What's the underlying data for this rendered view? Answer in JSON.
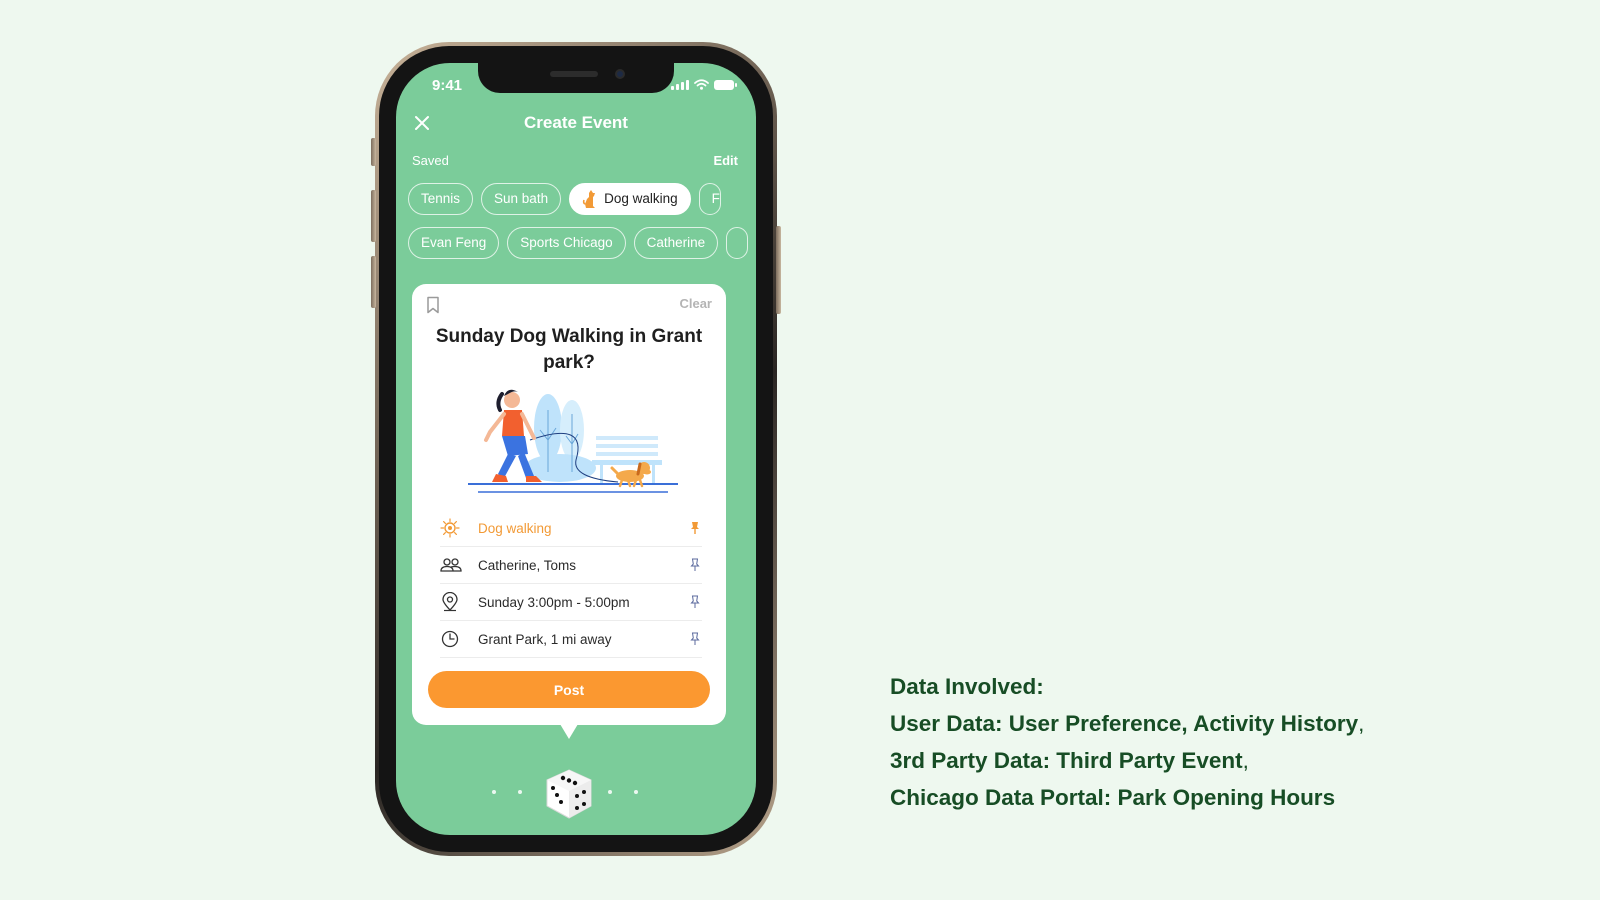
{
  "status_bar": {
    "time": "9:41"
  },
  "header": {
    "title": "Create Event",
    "saved_label": "Saved",
    "edit_label": "Edit"
  },
  "activity_chips": [
    {
      "label": "Tennis",
      "active": false
    },
    {
      "label": "Sun bath",
      "active": false
    },
    {
      "label": "Dog walking",
      "active": true,
      "icon": "dog-icon"
    },
    {
      "label": "F",
      "active": false,
      "truncated": true
    }
  ],
  "people_chips": [
    {
      "label": "Evan Feng"
    },
    {
      "label": "Sports Chicago"
    },
    {
      "label": "Catherine"
    },
    {
      "label": "",
      "truncated": true
    }
  ],
  "card": {
    "clear_label": "Clear",
    "title": "Sunday Dog Walking in Grant park?",
    "illustration": "woman-walking-dog-in-park-illustration",
    "details": [
      {
        "icon": "sun-icon",
        "text": "Dog walking",
        "pinned": true,
        "highlight": true
      },
      {
        "icon": "people-icon",
        "text": "Catherine, Toms",
        "pinned": false
      },
      {
        "icon": "location-icon",
        "text": "Sunday 3:00pm - 5:00pm",
        "pinned": false
      },
      {
        "icon": "clock-icon",
        "text": "Grant Park, 1 mi away",
        "pinned": false
      }
    ],
    "post_label": "Post"
  },
  "footer": {
    "icon": "dice-icon",
    "page_dots": 4
  },
  "info": {
    "heading": "Data Involved:",
    "line1_label": "User Data: User Preference, Activity History",
    "line1_sep": ",",
    "line2_label": "3rd Party Data: Third Party Event",
    "line2_sep": ",",
    "line3_label": "Chicago Data Portal: Park Opening Hours"
  },
  "colors": {
    "page_background": "#eef8ef",
    "screen_green": "#7bcc9a",
    "accent_orange": "#fb9830",
    "info_text": "#174d25"
  }
}
